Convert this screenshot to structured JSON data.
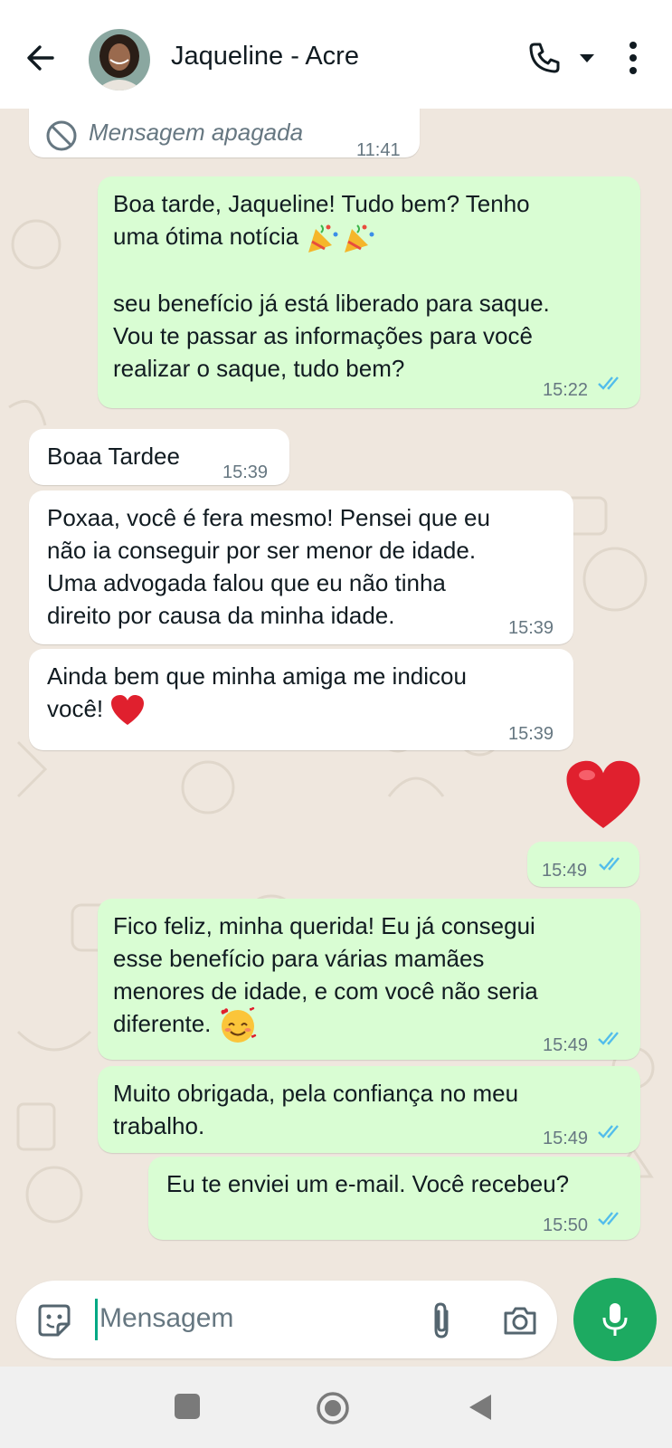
{
  "header": {
    "contact_name": "Jaqueline - Acre"
  },
  "messages": [
    {
      "direction": "in",
      "text": "Mensagem apagada",
      "time": "11:41",
      "deleted": true
    },
    {
      "direction": "out",
      "text": "Boa tarde, Jaqueline! Tudo bem? Tenho uma ótima notícia 🎉🎉\n\nseu benefício já está liberado para saque. Vou te passar as informações para você realizar o saque, tudo bem?",
      "time": "15:22",
      "status": "read"
    },
    {
      "direction": "in",
      "text": "Boaa Tardee",
      "time": "15:39"
    },
    {
      "direction": "in",
      "text": "Poxaa, você é fera mesmo! Pensei que eu não ia conseguir por ser menor de idade. Uma advogada falou que eu não tinha direito por causa da minha idade.",
      "time": "15:39"
    },
    {
      "direction": "in",
      "text": "Ainda bem que minha amiga me indicou você! ❤️",
      "time": "15:39"
    },
    {
      "direction": "out",
      "text": "❤️",
      "time": "15:49",
      "status": "read"
    },
    {
      "direction": "out",
      "text": "Fico feliz, minha querida! Eu já consegui esse benefício para várias mamães menores de idade, e com você não seria diferente. 🥰",
      "time": "15:49",
      "status": "read"
    },
    {
      "direction": "out",
      "text": "Muito obrigada, pela confiança no meu trabalho.",
      "time": "15:49",
      "status": "read"
    },
    {
      "direction": "out",
      "text": "Eu te enviei um e-mail. Você recebeu?",
      "time": "15:50",
      "status": "read"
    }
  ],
  "composer": {
    "placeholder": "Mensagem"
  },
  "colors": {
    "incoming_bubble": "#ffffff",
    "outgoing_bubble": "#d9fdd3",
    "read_ticks": "#53bdeb",
    "mic_button": "#1daa61",
    "chat_background": "#efe7de"
  },
  "icons": {
    "back": "arrow-left-icon",
    "call": "phone-icon",
    "menu": "more-vertical-icon",
    "deleted": "block-icon",
    "sticker": "sticker-icon",
    "attach": "paperclip-icon",
    "camera": "camera-icon",
    "mic": "mic-icon"
  }
}
